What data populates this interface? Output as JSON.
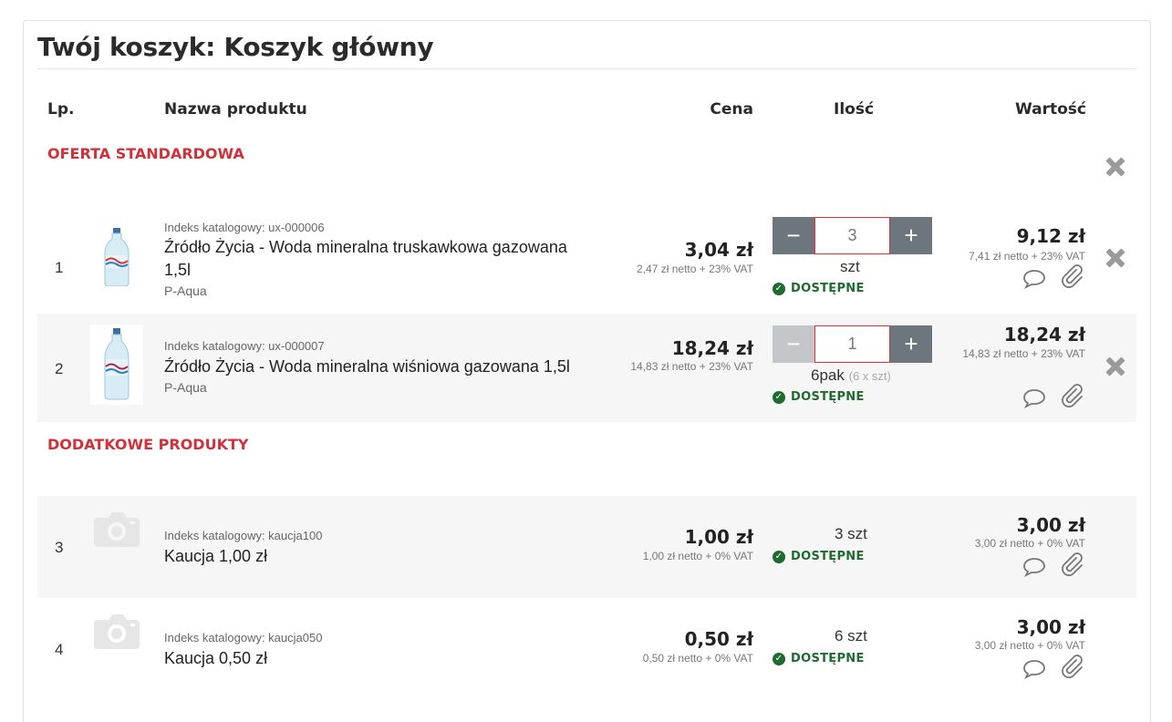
{
  "cart": {
    "title": "Twój koszyk: Koszyk główny"
  },
  "headers": {
    "lp": "Lp.",
    "name": "Nazwa produktu",
    "price": "Cena",
    "qty": "Ilość",
    "value": "Wartość"
  },
  "sections": {
    "standard": "OFERTA STANDARDOWA",
    "additional": "DODATKOWE PRODUKTY"
  },
  "items": [
    {
      "lp": "1",
      "index": "Indeks katalogowy: ux-000006",
      "name": "Źródło Życia - Woda mineralna truskawkowa gazowana 1,5l",
      "brand": "P-Aqua",
      "price": "3,04 zł",
      "price_sub": "2,47 zł netto + 23% VAT",
      "qty": "3",
      "unit": "szt",
      "availability": "DOSTĘPNE",
      "value": "9,12 zł",
      "value_sub": "7,41 zł netto + 23% VAT"
    },
    {
      "lp": "2",
      "index": "Indeks katalogowy: ux-000007",
      "name": "Źródło Życia - Woda mineralna wiśniowa gazowana 1,5l",
      "brand": "P-Aqua",
      "price": "18,24 zł",
      "price_sub": "14,83 zł netto + 23% VAT",
      "qty": "1",
      "unit": "6pak",
      "unit_note": "(6 x szt)",
      "availability": "DOSTĘPNE",
      "value": "18,24 zł",
      "value_sub": "14,83 zł netto + 23% VAT"
    },
    {
      "lp": "3",
      "index": "Indeks katalogowy: kaucja100",
      "name": "Kaucja 1,00 zł",
      "price": "1,00 zł",
      "price_sub": "1,00 zł netto + 0% VAT",
      "qty_text": "3 szt",
      "availability": "DOSTĘPNE",
      "value": "3,00 zł",
      "value_sub": "3,00 zł netto + 0% VAT"
    },
    {
      "lp": "4",
      "index": "Indeks katalogowy: kaucja050",
      "name": "Kaucja 0,50 zł",
      "price": "0,50 zł",
      "price_sub": "0,50 zł netto + 0% VAT",
      "qty_text": "6 szt",
      "availability": "DOSTĘPNE",
      "value": "3,00 zł",
      "value_sub": "3,00 zł netto + 0% VAT"
    }
  ],
  "colors": {
    "section": "#d0313a",
    "available": "#1f6b2f",
    "stepper": "#6d757d"
  }
}
